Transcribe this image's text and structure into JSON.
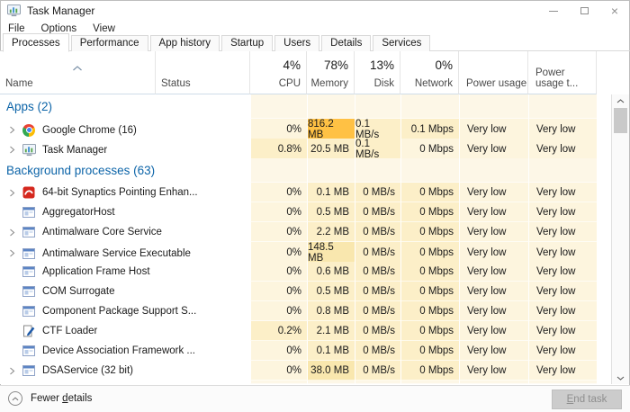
{
  "window": {
    "title": "Task Manager",
    "app_icon": "task-manager-icon",
    "control_icons": [
      "minimize-icon",
      "maximize-icon",
      "close-icon"
    ]
  },
  "menu": {
    "items": [
      "File",
      "Options",
      "View"
    ]
  },
  "tabs": {
    "active": "Processes",
    "items": [
      "Processes",
      "Performance",
      "App history",
      "Startup",
      "Users",
      "Details",
      "Services"
    ]
  },
  "header": {
    "name": "Name",
    "status": "Status",
    "sort_icon": "chevron-up-icon",
    "metrics": [
      {
        "pct": "4%",
        "label": "CPU"
      },
      {
        "pct": "78%",
        "label": "Memory"
      },
      {
        "pct": "13%",
        "label": "Disk"
      },
      {
        "pct": "0%",
        "label": "Network"
      }
    ],
    "power": "Power usage",
    "power_trend": "Power usage t..."
  },
  "colors": {
    "accent_blue": "#0c64a8",
    "heat_tone0": "#fdf5de",
    "heat_tone1": "#fcefc8",
    "heat_tone2": "#f9e7ae",
    "heat_tone3": "#ffc144",
    "heat_section": "#fdf7e7"
  },
  "sections": [
    {
      "label": "Apps (2)",
      "rows": [
        {
          "name": "Google Chrome (16)",
          "icon": "chrome-icon",
          "expandable": true,
          "cells": [
            {
              "v": "0%",
              "t": 0
            },
            {
              "v": "816.2 MB",
              "t": 3
            },
            {
              "v": "0.1 MB/s",
              "t": 1
            },
            {
              "v": "0.1 Mbps",
              "t": 1
            },
            {
              "v": "Very low",
              "t": 0
            },
            {
              "v": "Very low",
              "t": 0
            }
          ]
        },
        {
          "name": "Task Manager",
          "icon": "task-manager-icon",
          "expandable": true,
          "cells": [
            {
              "v": "0.8%",
              "t": 1
            },
            {
              "v": "20.5 MB",
              "t": 1
            },
            {
              "v": "0.1 MB/s",
              "t": 1
            },
            {
              "v": "0 Mbps",
              "t": 0
            },
            {
              "v": "Very low",
              "t": 0
            },
            {
              "v": "Very low",
              "t": 0
            }
          ]
        }
      ]
    },
    {
      "label": "Background processes (63)",
      "rows": [
        {
          "name": "64-bit Synaptics Pointing Enhan...",
          "icon": "synaptics-icon",
          "expandable": true,
          "cells": [
            {
              "v": "0%",
              "t": 0
            },
            {
              "v": "0.1 MB",
              "t": 1
            },
            {
              "v": "0 MB/s",
              "t": 1
            },
            {
              "v": "0 Mbps",
              "t": 1
            },
            {
              "v": "Very low",
              "t": 0
            },
            {
              "v": "Very low",
              "t": 0
            }
          ]
        },
        {
          "name": "AggregatorHost",
          "icon": "generic-app-icon",
          "expandable": false,
          "cells": [
            {
              "v": "0%",
              "t": 0
            },
            {
              "v": "0.5 MB",
              "t": 1
            },
            {
              "v": "0 MB/s",
              "t": 1
            },
            {
              "v": "0 Mbps",
              "t": 1
            },
            {
              "v": "Very low",
              "t": 0
            },
            {
              "v": "Very low",
              "t": 0
            }
          ]
        },
        {
          "name": "Antimalware Core Service",
          "icon": "generic-app-icon",
          "expandable": true,
          "cells": [
            {
              "v": "0%",
              "t": 0
            },
            {
              "v": "2.2 MB",
              "t": 1
            },
            {
              "v": "0 MB/s",
              "t": 1
            },
            {
              "v": "0 Mbps",
              "t": 1
            },
            {
              "v": "Very low",
              "t": 0
            },
            {
              "v": "Very low",
              "t": 0
            }
          ]
        },
        {
          "name": "Antimalware Service Executable",
          "icon": "generic-app-icon",
          "expandable": true,
          "cells": [
            {
              "v": "0%",
              "t": 0
            },
            {
              "v": "148.5 MB",
              "t": 2
            },
            {
              "v": "0 MB/s",
              "t": 1
            },
            {
              "v": "0 Mbps",
              "t": 1
            },
            {
              "v": "Very low",
              "t": 0
            },
            {
              "v": "Very low",
              "t": 0
            }
          ]
        },
        {
          "name": "Application Frame Host",
          "icon": "generic-app-icon",
          "expandable": false,
          "cells": [
            {
              "v": "0%",
              "t": 0
            },
            {
              "v": "0.6 MB",
              "t": 1
            },
            {
              "v": "0 MB/s",
              "t": 1
            },
            {
              "v": "0 Mbps",
              "t": 1
            },
            {
              "v": "Very low",
              "t": 0
            },
            {
              "v": "Very low",
              "t": 0
            }
          ]
        },
        {
          "name": "COM Surrogate",
          "icon": "generic-app-icon",
          "expandable": false,
          "cells": [
            {
              "v": "0%",
              "t": 0
            },
            {
              "v": "0.5 MB",
              "t": 1
            },
            {
              "v": "0 MB/s",
              "t": 1
            },
            {
              "v": "0 Mbps",
              "t": 1
            },
            {
              "v": "Very low",
              "t": 0
            },
            {
              "v": "Very low",
              "t": 0
            }
          ]
        },
        {
          "name": "Component Package Support S...",
          "icon": "generic-app-icon",
          "expandable": false,
          "cells": [
            {
              "v": "0%",
              "t": 0
            },
            {
              "v": "0.8 MB",
              "t": 1
            },
            {
              "v": "0 MB/s",
              "t": 1
            },
            {
              "v": "0 Mbps",
              "t": 1
            },
            {
              "v": "Very low",
              "t": 0
            },
            {
              "v": "Very low",
              "t": 0
            }
          ]
        },
        {
          "name": "CTF Loader",
          "icon": "ctf-loader-icon",
          "expandable": false,
          "cells": [
            {
              "v": "0.2%",
              "t": 1
            },
            {
              "v": "2.1 MB",
              "t": 1
            },
            {
              "v": "0 MB/s",
              "t": 1
            },
            {
              "v": "0 Mbps",
              "t": 1
            },
            {
              "v": "Very low",
              "t": 0
            },
            {
              "v": "Very low",
              "t": 0
            }
          ]
        },
        {
          "name": "Device Association Framework ...",
          "icon": "generic-app-icon",
          "expandable": false,
          "cells": [
            {
              "v": "0%",
              "t": 0
            },
            {
              "v": "0.1 MB",
              "t": 1
            },
            {
              "v": "0 MB/s",
              "t": 1
            },
            {
              "v": "0 Mbps",
              "t": 1
            },
            {
              "v": "Very low",
              "t": 0
            },
            {
              "v": "Very low",
              "t": 0
            }
          ]
        },
        {
          "name": "DSAService (32 bit)",
          "icon": "generic-app-icon",
          "expandable": true,
          "cells": [
            {
              "v": "0%",
              "t": 0
            },
            {
              "v": "38.0 MB",
              "t": 2
            },
            {
              "v": "0 MB/s",
              "t": 1
            },
            {
              "v": "0 Mbps",
              "t": 1
            },
            {
              "v": "Very low",
              "t": 0
            },
            {
              "v": "Very low",
              "t": 0
            }
          ]
        }
      ]
    }
  ],
  "scrollbar": {
    "up_icon": "chevron-up-icon",
    "down_icon": "chevron-down-icon"
  },
  "footer": {
    "fewer_details": {
      "text": "Fewer details",
      "accel_index": 6
    },
    "end_task": {
      "text": "End task",
      "accel_index": 0
    },
    "toggle_icon": "chevron-up-circle-icon"
  }
}
